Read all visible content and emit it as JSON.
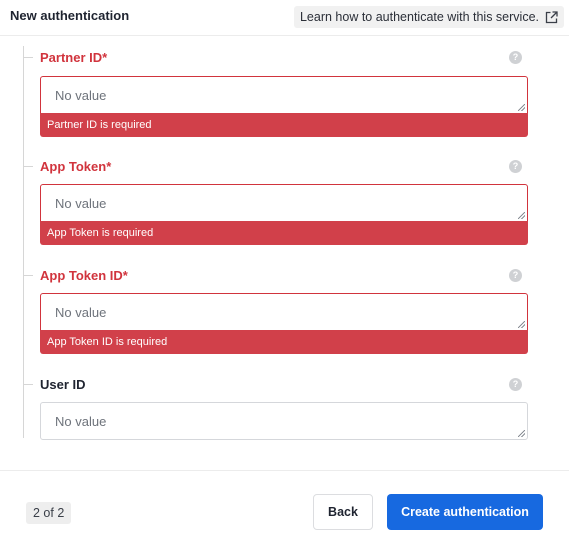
{
  "header": {
    "title": "New authentication",
    "learn_link_label": "Learn how to authenticate with this service.",
    "learn_link_icon": "external-link-icon"
  },
  "fields": [
    {
      "label": "Partner ID*",
      "placeholder": "No value",
      "error": "Partner ID is required",
      "has_error": true
    },
    {
      "label": "App Token*",
      "placeholder": "No value",
      "error": "App Token is required",
      "has_error": true
    },
    {
      "label": "App Token ID*",
      "placeholder": "No value",
      "error": "App Token ID is required",
      "has_error": true
    },
    {
      "label": "User ID",
      "placeholder": "No value",
      "has_error": false
    }
  ],
  "help_icon": "question-circle-icon",
  "help_glyph": "?",
  "footer": {
    "page_indicator": "2 of 2",
    "back_label": "Back",
    "create_label": "Create authentication"
  },
  "colors": {
    "error": "#d1343d",
    "primary": "#1769e0"
  }
}
